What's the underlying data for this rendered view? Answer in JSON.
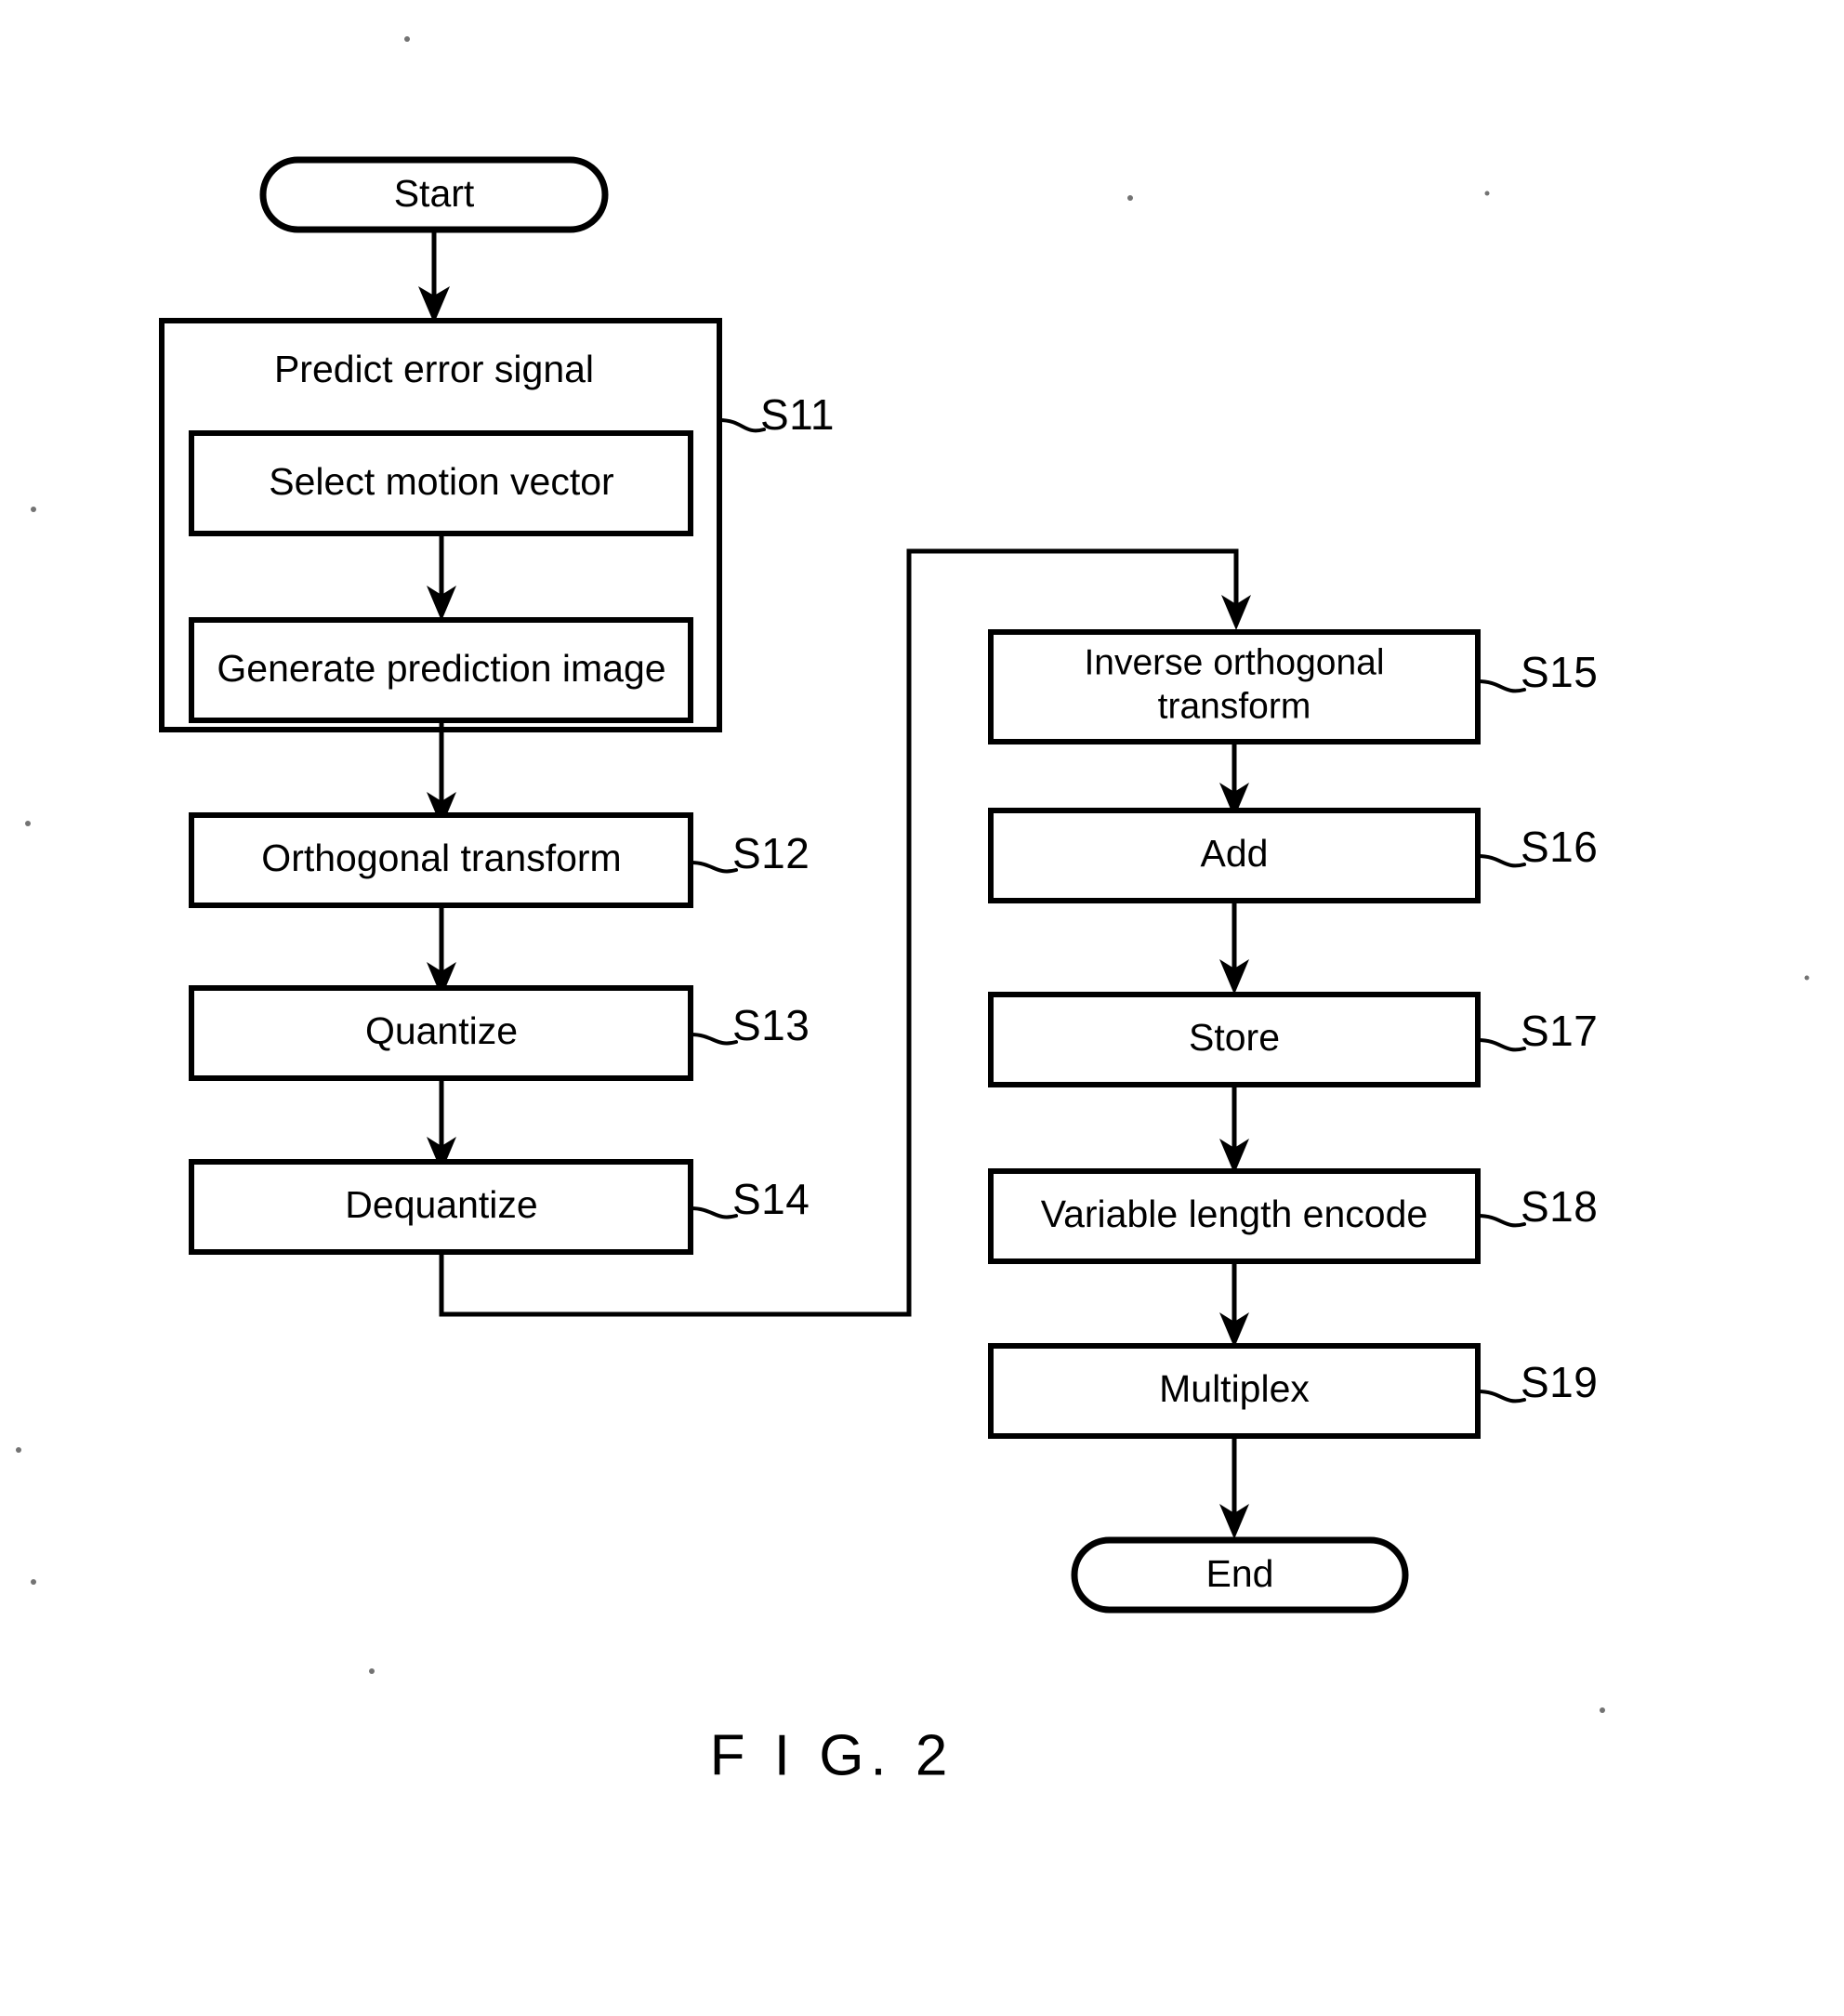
{
  "figure": {
    "caption": "F I G. 2",
    "title_text": "F I G. 2"
  },
  "terminals": {
    "start": "Start",
    "end": "End"
  },
  "nodes": {
    "predict_error_signal": "Predict error signal",
    "select_motion_vector": "Select motion vector",
    "generate_prediction_image": "Generate prediction image",
    "orthogonal_transform": "Orthogonal transform",
    "quantize": "Quantize",
    "dequantize": "Dequantize",
    "inverse_orthogonal_transform_line1": "Inverse orthogonal",
    "inverse_orthogonal_transform_line2": "transform",
    "add": "Add",
    "store": "Store",
    "variable_length_encode": "Variable length encode",
    "multiplex": "Multiplex"
  },
  "step_labels": {
    "s11": "S11",
    "s12": "S12",
    "s13": "S13",
    "s14": "S14",
    "s15": "S15",
    "s16": "S16",
    "s17": "S17",
    "s18": "S18",
    "s19": "S19"
  },
  "colors": {
    "ink": "#000000",
    "paper": "#ffffff"
  }
}
